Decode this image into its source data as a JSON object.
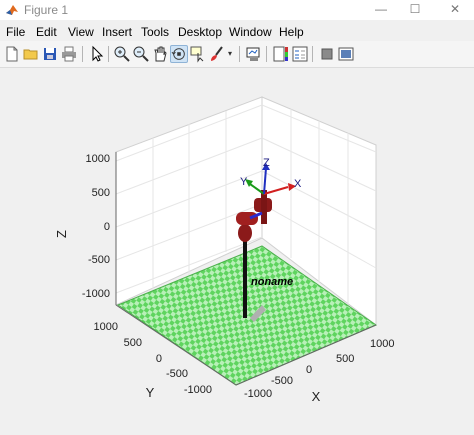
{
  "window": {
    "title": "Figure 1",
    "controls": {
      "minimize": "—",
      "maximize": "☐",
      "close": "✕"
    }
  },
  "menu": [
    "File",
    "Edit",
    "View",
    "Insert",
    "Tools",
    "Desktop",
    "Window",
    "Help"
  ],
  "toolbar": {
    "items": [
      "new-figure-icon",
      "open-file-icon",
      "save-icon",
      "print-icon",
      "pointer-icon",
      "zoom-in-icon",
      "zoom-out-icon",
      "pan-icon",
      "rotate-3d-icon",
      "data-cursor-icon",
      "brush-icon",
      "colorbar-icon",
      "legend-icon",
      "hide-plot-tools-icon",
      "show-plot-tools-icon"
    ],
    "active": "rotate-3d-icon"
  },
  "axes": {
    "zlabel": "Z",
    "ylabel": "Y",
    "xlabel": "X",
    "z_ticks": [
      "1000",
      "500",
      "0",
      "-500",
      "-1000"
    ],
    "y_ticks": [
      "1000",
      "500",
      "0",
      "-500",
      "-1000"
    ],
    "x_ticks": [
      "1000",
      "500",
      "0",
      "-500",
      "-1000"
    ],
    "grid": true,
    "floor_color": "#7ee07e"
  },
  "robot": {
    "name_label": "noname",
    "frame_labels": {
      "x": "X",
      "y": "Y",
      "z": "Z"
    },
    "colors": {
      "link": "#8b1a1a",
      "base": "#111111",
      "x_axis": "#d22020",
      "y_axis": "#1a9a1a",
      "z_axis": "#2030c0"
    }
  }
}
